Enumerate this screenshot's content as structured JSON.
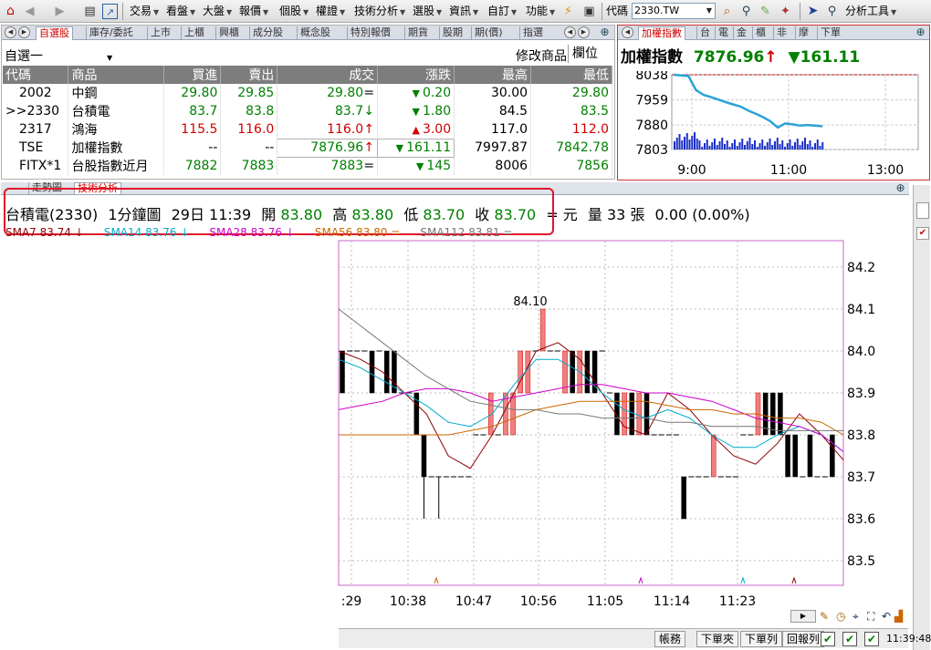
{
  "toolbar": {
    "menus": [
      "交易",
      "看盤",
      "大盤",
      "報價",
      "個股",
      "權證",
      "技術分析",
      "選股",
      "資訊",
      "自訂",
      "功能"
    ],
    "code_label": "代碼",
    "code_value": "2330.TW",
    "tools_label": "分析工具"
  },
  "watchlist": {
    "tabs": [
      "自選股",
      "庫存/委託",
      "上市",
      "上櫃",
      "興櫃",
      "成分股",
      "概念股",
      "特別報價",
      "期貨",
      "股期",
      "期(價)",
      "指選"
    ],
    "group": "自選一",
    "edit_label": "修改商品",
    "field_label": "欄位",
    "columns": [
      "代碼",
      "商品",
      "買進",
      "賣出",
      "成交",
      "漲跌",
      "最高",
      "最低"
    ],
    "rows": [
      {
        "code": "2002",
        "name": "中鋼",
        "bid": "29.80",
        "ask": "29.85",
        "last": "29.80",
        "mark": "=",
        "chg": "0.20",
        "dir": "down",
        "high": "30.00",
        "low": "29.80",
        "color": "green"
      },
      {
        "code": ">>2330",
        "name": "台積電",
        "bid": "83.7",
        "ask": "83.8",
        "last": "83.7",
        "mark": "↓",
        "chg": "1.80",
        "dir": "down",
        "high": "84.5",
        "low": "83.5",
        "color": "green"
      },
      {
        "code": "2317",
        "name": "鴻海",
        "bid": "115.5",
        "ask": "116.0",
        "last": "116.0",
        "mark": "↑",
        "chg": "3.00",
        "dir": "up",
        "high": "117.0",
        "low": "112.0",
        "color": "red"
      },
      {
        "code": "TSE",
        "name": "加權指數",
        "bid": "--",
        "ask": "--",
        "last": "7876.96",
        "mark": "↑",
        "chg": "161.11",
        "dir": "down",
        "high": "7997.87",
        "low": "7842.78",
        "color": "green"
      },
      {
        "code": "FITX*1",
        "name": "台股指數近月",
        "bid": "7882",
        "ask": "7883",
        "last": "7883",
        "mark": "=",
        "chg": "145",
        "dir": "down",
        "high": "8006",
        "low": "7856",
        "color": "green"
      }
    ]
  },
  "index_panel": {
    "tabs": [
      "加權指數",
      "台",
      "電",
      "金",
      "櫃",
      "非",
      "摩",
      "下單"
    ],
    "title": "加權指數",
    "value": "7876.96",
    "value_mark": "↑",
    "change": "▼161.11",
    "y_ticks": [
      "8038",
      "7959",
      "7880",
      "7803"
    ],
    "x_ticks": [
      "9:00",
      "11:00",
      "13:00"
    ]
  },
  "kline": {
    "tabs": [
      "走勢圖",
      "技術分析"
    ],
    "info": {
      "symbol": "台積電(2330)",
      "period": "1分鐘圖",
      "datetime": "29日 11:39",
      "open_label": "開",
      "open": "83.80",
      "high_label": "高",
      "high": "83.80",
      "low_label": "低",
      "low": "83.70",
      "close_label": "收",
      "close": "83.70",
      "unit": "= 元",
      "vol_label": "量 33 張",
      "change": "0.00 (0.00%)"
    },
    "ma_labels": [
      {
        "text": "SMA7 83.74 ↓",
        "color": "#8b0000"
      },
      {
        "text": "SMA14 83.76 ↓",
        "color": "#00aacc"
      },
      {
        "text": "SMA28 83.76 ↓",
        "color": "#cc00cc"
      },
      {
        "text": "SMA56 83.80 =",
        "color": "#cc6600"
      },
      {
        "text": "SMA112 83.81 =",
        "color": "#777777"
      }
    ],
    "peak_label": "84.10",
    "y_ticks": [
      "84.2",
      "84.1",
      "84.0",
      "83.9",
      "83.8",
      "83.7",
      "83.6",
      "83.5"
    ],
    "x_ticks": [
      ":29",
      "10:38",
      "10:47",
      "10:56",
      "11:05",
      "11:14",
      "11:23"
    ]
  },
  "status_bar": {
    "buttons": [
      "帳務",
      "下單夾",
      "下單列",
      "回報列"
    ],
    "checks": [
      "✔",
      "✔",
      "✔"
    ],
    "time": "11:39:48"
  },
  "colors": {
    "up": "#d00000",
    "down": "#008000",
    "header_bg": "#7d7d7d",
    "highlight_box": "#e0142a"
  },
  "chart_data": [
    {
      "type": "line",
      "title": "加權指數",
      "x_ticks": [
        "9:00",
        "11:00",
        "13:00"
      ],
      "ylim": [
        7803,
        8038
      ],
      "y_ticks": [
        8038,
        7959,
        7880,
        7803
      ],
      "series": [
        {
          "values": [
            8038,
            8036,
            8034,
            7990,
            7975,
            7968,
            7960,
            7952,
            7945,
            7938,
            7926,
            7916,
            7905,
            7892,
            7872,
            7885,
            7882,
            7878,
            7880,
            7878,
            7876
          ]
        }
      ]
    },
    {
      "type": "candlestick",
      "title": "",
      "x_ticks": [
        ":29",
        "10:38",
        "10:47",
        "10:56",
        "11:05",
        "11:14",
        "11:23"
      ],
      "ylim": [
        83.45,
        84.25
      ],
      "y_ticks": [
        84.2,
        84.1,
        84.0,
        83.9,
        83.8,
        83.7,
        83.6,
        83.5
      ],
      "candles": [
        {
          "o": 84.0,
          "c": 83.9,
          "h": 84.0,
          "l": 83.9
        },
        {
          "o": 84.0,
          "c": 84.0,
          "h": 84.0,
          "l": 84.0
        },
        {
          "o": 84.0,
          "c": 84.0,
          "h": 84.0,
          "l": 84.0
        },
        {
          "o": 84.0,
          "c": 84.0,
          "h": 84.0,
          "l": 84.0
        },
        {
          "o": 84.0,
          "c": 83.9,
          "h": 84.0,
          "l": 83.9
        },
        {
          "o": 84.0,
          "c": 84.0,
          "h": 84.0,
          "l": 84.0
        },
        {
          "o": 84.0,
          "c": 83.9,
          "h": 84.0,
          "l": 83.9
        },
        {
          "o": 84.0,
          "c": 83.9,
          "h": 84.0,
          "l": 83.9
        },
        {
          "o": 83.9,
          "c": 83.9,
          "h": 83.9,
          "l": 83.9
        },
        {
          "o": 83.9,
          "c": 83.9,
          "h": 83.9,
          "l": 83.9
        },
        {
          "o": 83.9,
          "c": 83.8,
          "h": 83.9,
          "l": 83.8
        },
        {
          "o": 83.8,
          "c": 83.7,
          "h": 83.8,
          "l": 83.6
        },
        {
          "o": 83.7,
          "c": 83.7,
          "h": 83.7,
          "l": 83.7
        },
        {
          "o": 83.7,
          "c": 83.7,
          "h": 83.7,
          "l": 83.6
        },
        {
          "o": 83.7,
          "c": 83.7,
          "h": 83.7,
          "l": 83.7
        },
        {
          "o": 83.7,
          "c": 83.7,
          "h": 83.7,
          "l": 83.7
        },
        {
          "o": 83.7,
          "c": 83.7,
          "h": 83.7,
          "l": 83.7
        },
        {
          "o": 83.7,
          "c": 83.7,
          "h": 83.7,
          "l": 83.7
        },
        {
          "o": 83.8,
          "c": 83.8,
          "h": 83.8,
          "l": 83.8
        },
        {
          "o": 83.8,
          "c": 83.8,
          "h": 83.8,
          "l": 83.8
        },
        {
          "o": 83.8,
          "c": 83.9,
          "h": 83.9,
          "l": 83.8
        },
        {
          "o": 83.8,
          "c": 83.8,
          "h": 83.8,
          "l": 83.8
        },
        {
          "o": 83.8,
          "c": 83.9,
          "h": 83.9,
          "l": 83.8
        },
        {
          "o": 83.8,
          "c": 83.9,
          "h": 83.9,
          "l": 83.8
        },
        {
          "o": 83.9,
          "c": 84.0,
          "h": 84.0,
          "l": 83.9
        },
        {
          "o": 83.9,
          "c": 84.0,
          "h": 84.0,
          "l": 83.9
        },
        {
          "o": 84.0,
          "c": 84.0,
          "h": 84.0,
          "l": 84.0
        },
        {
          "o": 84.0,
          "c": 84.1,
          "h": 84.1,
          "l": 84.0
        },
        {
          "o": 84.0,
          "c": 84.0,
          "h": 84.0,
          "l": 84.0
        },
        {
          "o": 84.0,
          "c": 84.0,
          "h": 84.0,
          "l": 84.0
        },
        {
          "o": 83.9,
          "c": 84.0,
          "h": 84.0,
          "l": 83.9
        },
        {
          "o": 84.0,
          "c": 83.9,
          "h": 84.0,
          "l": 83.9
        },
        {
          "o": 83.9,
          "c": 84.0,
          "h": 84.0,
          "l": 83.9
        },
        {
          "o": 84.0,
          "c": 83.9,
          "h": 84.0,
          "l": 83.9
        },
        {
          "o": 84.0,
          "c": 83.9,
          "h": 84.0,
          "l": 83.9
        },
        {
          "o": 84.0,
          "c": 84.0,
          "h": 84.0,
          "l": 84.0
        },
        {
          "o": 83.9,
          "c": 83.9,
          "h": 83.9,
          "l": 83.9
        },
        {
          "o": 83.9,
          "c": 83.8,
          "h": 83.9,
          "l": 83.8
        },
        {
          "o": 83.8,
          "c": 83.9,
          "h": 83.9,
          "l": 83.8
        },
        {
          "o": 83.9,
          "c": 83.8,
          "h": 83.9,
          "l": 83.8
        },
        {
          "o": 83.8,
          "c": 83.9,
          "h": 83.9,
          "l": 83.8
        },
        {
          "o": 83.9,
          "c": 83.8,
          "h": 83.9,
          "l": 83.8
        },
        {
          "o": 83.8,
          "c": 83.8,
          "h": 83.8,
          "l": 83.8
        },
        {
          "o": 83.8,
          "c": 83.8,
          "h": 83.8,
          "l": 83.8
        },
        {
          "o": 83.8,
          "c": 83.8,
          "h": 83.8,
          "l": 83.8
        },
        {
          "o": 83.8,
          "c": 83.8,
          "h": 83.8,
          "l": 83.8
        },
        {
          "o": 83.7,
          "c": 83.6,
          "h": 83.7,
          "l": 83.6
        },
        {
          "o": 83.7,
          "c": 83.7,
          "h": 83.7,
          "l": 83.7
        },
        {
          "o": 83.7,
          "c": 83.7,
          "h": 83.7,
          "l": 83.7
        },
        {
          "o": 83.7,
          "c": 83.7,
          "h": 83.7,
          "l": 83.7
        },
        {
          "o": 83.7,
          "c": 83.8,
          "h": 83.8,
          "l": 83.7
        },
        {
          "o": 83.7,
          "c": 83.7,
          "h": 83.7,
          "l": 83.7
        },
        {
          "o": 83.7,
          "c": 83.7,
          "h": 83.7,
          "l": 83.7
        },
        {
          "o": 83.7,
          "c": 83.7,
          "h": 83.7,
          "l": 83.7
        },
        {
          "o": 83.8,
          "c": 83.8,
          "h": 83.8,
          "l": 83.8
        },
        {
          "o": 83.8,
          "c": 83.8,
          "h": 83.8,
          "l": 83.8
        },
        {
          "o": 83.8,
          "c": 83.9,
          "h": 83.9,
          "l": 83.8
        },
        {
          "o": 83.9,
          "c": 83.8,
          "h": 83.9,
          "l": 83.8
        },
        {
          "o": 83.9,
          "c": 83.8,
          "h": 83.9,
          "l": 83.8
        },
        {
          "o": 83.9,
          "c": 83.8,
          "h": 83.9,
          "l": 83.8
        },
        {
          "o": 83.8,
          "c": 83.7,
          "h": 83.8,
          "l": 83.7
        },
        {
          "o": 83.8,
          "c": 83.7,
          "h": 83.8,
          "l": 83.7
        },
        {
          "o": 83.7,
          "c": 83.7,
          "h": 83.7,
          "l": 83.7
        },
        {
          "o": 83.8,
          "c": 83.7,
          "h": 83.8,
          "l": 83.7
        },
        {
          "o": 83.7,
          "c": 83.7,
          "h": 83.7,
          "l": 83.7
        },
        {
          "o": 83.7,
          "c": 83.7,
          "h": 83.7,
          "l": 83.7
        },
        {
          "o": 83.8,
          "c": 83.7,
          "h": 83.8,
          "l": 83.7
        }
      ],
      "ma_lines": [
        {
          "name": "SMA7",
          "color": "#8b0000",
          "values": [
            84.0,
            83.98,
            83.95,
            83.9,
            83.85,
            83.75,
            83.72,
            83.8,
            83.9,
            84.0,
            84.02,
            83.98,
            83.9,
            83.82,
            83.8,
            83.9,
            83.86,
            83.8,
            83.75,
            83.73,
            83.78,
            83.85,
            83.8,
            83.74
          ]
        },
        {
          "name": "SMA14",
          "color": "#00aacc",
          "values": [
            83.98,
            83.96,
            83.93,
            83.9,
            83.87,
            83.83,
            83.82,
            83.85,
            83.92,
            83.98,
            83.98,
            83.95,
            83.9,
            83.86,
            83.84,
            83.86,
            83.84,
            83.8,
            83.77,
            83.77,
            83.8,
            83.82,
            83.8,
            83.76
          ]
        },
        {
          "name": "SMA28",
          "color": "#cc00cc",
          "values": [
            83.86,
            83.87,
            83.88,
            83.9,
            83.91,
            83.91,
            83.9,
            83.88,
            83.89,
            83.9,
            83.91,
            83.92,
            83.92,
            83.91,
            83.9,
            83.9,
            83.89,
            83.88,
            83.86,
            83.84,
            83.83,
            83.82,
            83.8,
            83.76
          ]
        },
        {
          "name": "SMA56",
          "color": "#cc6600",
          "values": [
            83.8,
            83.8,
            83.8,
            83.8,
            83.8,
            83.8,
            83.81,
            83.82,
            83.84,
            83.86,
            83.87,
            83.88,
            83.88,
            83.88,
            83.88,
            83.87,
            83.86,
            83.86,
            83.85,
            83.85,
            83.84,
            83.84,
            83.83,
            83.8
          ]
        },
        {
          "name": "SMA112",
          "color": "#777777",
          "values": [
            84.1,
            84.06,
            84.02,
            83.98,
            83.94,
            83.91,
            83.88,
            83.87,
            83.86,
            83.86,
            83.85,
            83.85,
            83.84,
            83.84,
            83.84,
            83.83,
            83.83,
            83.82,
            83.82,
            83.82,
            83.81,
            83.81,
            83.81,
            83.81
          ]
        }
      ]
    }
  ]
}
